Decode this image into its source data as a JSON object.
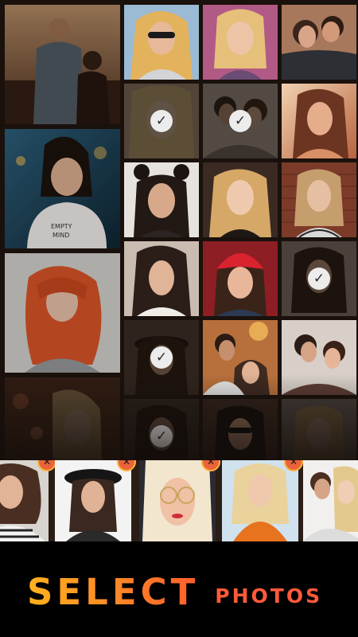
{
  "title": {
    "main": "SELECT",
    "sub": "PHOTOS"
  },
  "selected_check_icon": "✓",
  "remove_icon": "✕",
  "colors": {
    "accent_orange": "#ff8428",
    "accent_red": "#ff5a3a",
    "remove_badge": "#e9643a",
    "background": "#000000"
  },
  "left_column": [
    {
      "id": "couple-city-view",
      "selected": false
    },
    {
      "id": "woman-empty-your-mind-shirt",
      "selected": false
    },
    {
      "id": "woman-red-hair",
      "selected": false
    },
    {
      "id": "woman-blonde-flowers",
      "selected": false
    }
  ],
  "grid": [
    {
      "id": "woman-sunglasses",
      "selected": false
    },
    {
      "id": "woman-blonde-portrait",
      "selected": false
    },
    {
      "id": "couple-hug",
      "selected": false
    },
    {
      "id": "woman-blonde-closeup",
      "selected": true
    },
    {
      "id": "couple-beach",
      "selected": true
    },
    {
      "id": "woman-sunset",
      "selected": false
    },
    {
      "id": "woman-space-buns",
      "selected": false
    },
    {
      "id": "woman-wavy-blonde",
      "selected": false
    },
    {
      "id": "woman-brick-wall",
      "selected": false
    },
    {
      "id": "woman-dark-hair",
      "selected": false
    },
    {
      "id": "woman-red-beanie",
      "selected": false
    },
    {
      "id": "woman-striped-shirt",
      "selected": true
    },
    {
      "id": "woman-hat-portrait",
      "selected": true
    },
    {
      "id": "couple-autumn",
      "selected": false
    },
    {
      "id": "couple-laughing",
      "selected": false
    },
    {
      "id": "woman-smiling",
      "selected": true
    },
    {
      "id": "woman-sunglasses-street",
      "selected": false
    },
    {
      "id": "woman-beach",
      "selected": false
    }
  ],
  "tray": [
    {
      "id": "woman-curly-striped"
    },
    {
      "id": "woman-black-hat"
    },
    {
      "id": "woman-round-glasses"
    },
    {
      "id": "woman-orange-scarf"
    },
    {
      "id": "couple-white"
    }
  ]
}
